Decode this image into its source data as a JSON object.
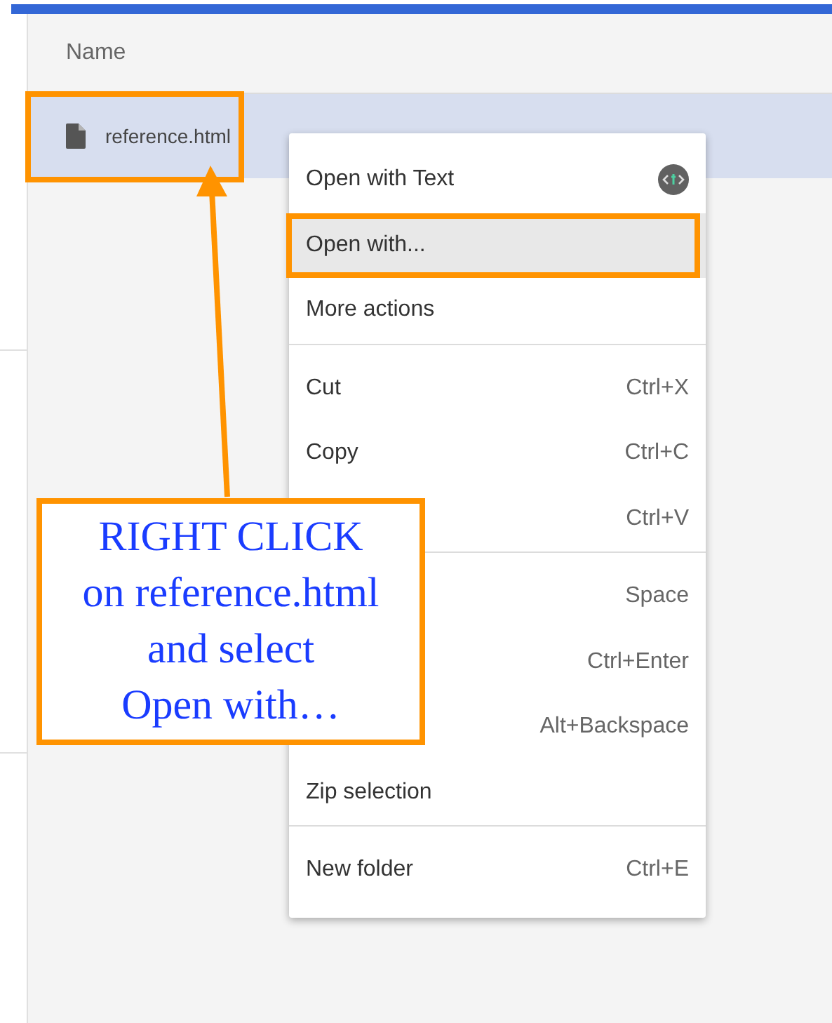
{
  "file_list": {
    "column_header": "Name",
    "rows": [
      {
        "name": "reference.html",
        "selected": true
      }
    ]
  },
  "context_menu": {
    "groups": [
      [
        {
          "kind": "app",
          "label": "Open with Text",
          "highlighted": false
        },
        {
          "kind": "item",
          "label": "Open with...",
          "highlighted": true
        },
        {
          "kind": "item",
          "label": "More actions",
          "highlighted": false
        }
      ],
      [
        {
          "kind": "item",
          "label": "Cut",
          "shortcut": "Ctrl+X",
          "highlighted": false
        },
        {
          "kind": "item",
          "label": "Copy",
          "shortcut": "Ctrl+C",
          "highlighted": false
        },
        {
          "kind": "item",
          "shortcut": "Ctrl+V",
          "highlighted": false
        }
      ],
      [
        {
          "kind": "item",
          "shortcut": "Space",
          "highlighted": false
        },
        {
          "kind": "item",
          "shortcut": "Ctrl+Enter",
          "highlighted": false
        },
        {
          "kind": "item",
          "shortcut": "Alt+Backspace",
          "highlighted": false
        },
        {
          "kind": "item",
          "label": "Zip selection",
          "highlighted": false
        }
      ],
      [
        {
          "kind": "item",
          "label": "New folder",
          "shortcut": "Ctrl+E",
          "highlighted": false
        }
      ]
    ]
  },
  "annotation": {
    "callout_lines": [
      "RIGHT CLICK",
      "on reference.html",
      "and select",
      "Open with…"
    ]
  }
}
